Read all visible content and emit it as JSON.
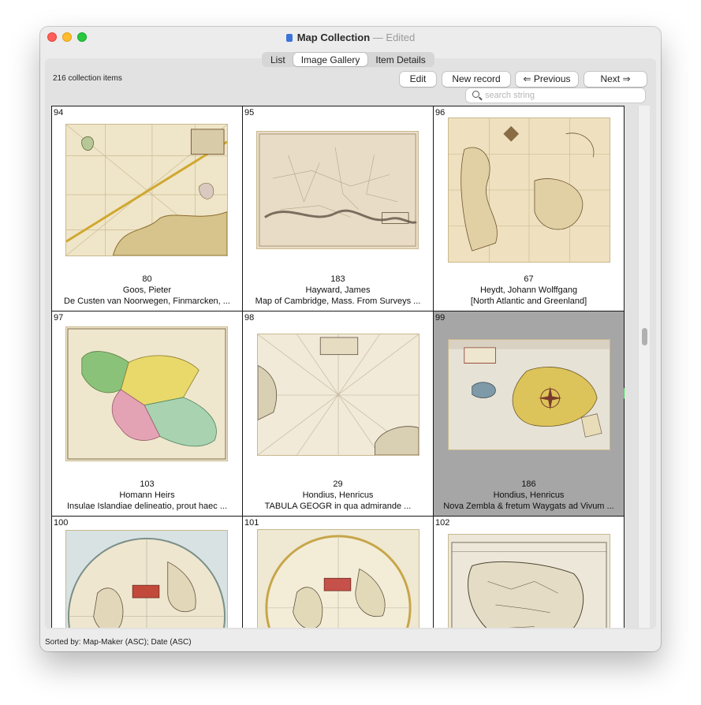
{
  "window": {
    "title": "Map Collection",
    "title_separator": "—",
    "edited": "Edited"
  },
  "tabs": [
    {
      "label": "List",
      "active": false
    },
    {
      "label": "Image Gallery",
      "active": true
    },
    {
      "label": "Item Details",
      "active": false
    }
  ],
  "toolbar": {
    "count_label": "216 collection items",
    "edit_label": "Edit",
    "new_record_label": "New record",
    "previous_label": "⇐ Previous",
    "next_label": "Next ⇒"
  },
  "search": {
    "placeholder": "search string",
    "value": ""
  },
  "gallery": {
    "items": [
      {
        "index": "94",
        "number": "80",
        "maker": "Goos, Pieter",
        "title": "De Custen van Noorwegen, Finmarcken, ...",
        "selected": false
      },
      {
        "index": "95",
        "number": "183",
        "maker": "Hayward, James",
        "title": "Map of Cambridge, Mass. From Surveys ...",
        "selected": false
      },
      {
        "index": "96",
        "number": "67",
        "maker": "Heydt, Johann Wolffgang",
        "title": "[North Atlantic and Greenland]",
        "selected": false
      },
      {
        "index": "97",
        "number": "103",
        "maker": "Homann Heirs",
        "title": "Insulae Islandiae delineatio, prout haec ...",
        "selected": false
      },
      {
        "index": "98",
        "number": "29",
        "maker": "Hondius, Henricus",
        "title": "TABULA GEOGR in qua admirande ...",
        "selected": false
      },
      {
        "index": "99",
        "number": "186",
        "maker": "Hondius, Henricus",
        "title": "Nova Zembla & fretum Waygats ad Vivum ...",
        "selected": true
      },
      {
        "index": "100",
        "number": "",
        "maker": "",
        "title": "",
        "selected": false
      },
      {
        "index": "101",
        "number": "",
        "maker": "",
        "title": "",
        "selected": false
      },
      {
        "index": "102",
        "number": "",
        "maker": "",
        "title": "",
        "selected": false
      }
    ]
  },
  "statusbar": {
    "sort_label": "Sorted by: Map-Maker (ASC); Date (ASC)"
  },
  "colors": {
    "selection": "#a6a6a6",
    "selection_arrow": "#3fd957",
    "accent": "#3b73d9"
  }
}
